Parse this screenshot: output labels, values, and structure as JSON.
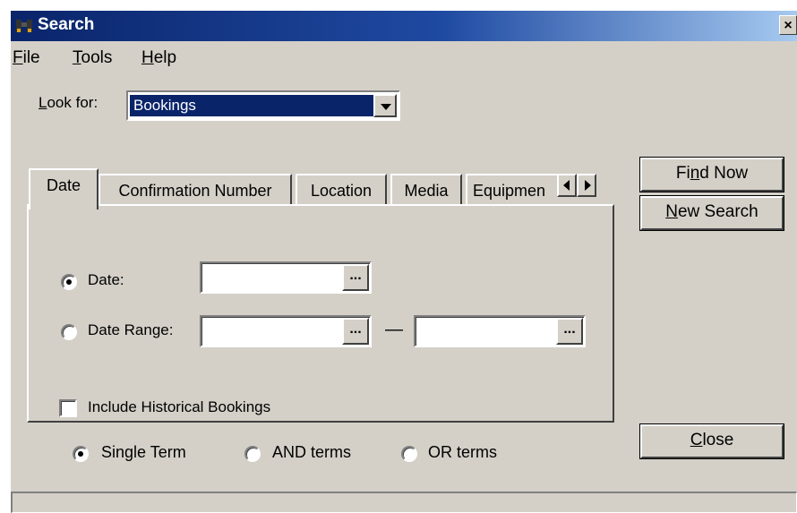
{
  "window": {
    "title": "Search",
    "close_glyph": "×"
  },
  "menu": [
    {
      "mnemonic": "F",
      "rest": "ile"
    },
    {
      "mnemonic": "T",
      "rest": "ools"
    },
    {
      "mnemonic": "H",
      "rest": "elp"
    }
  ],
  "look_for": {
    "mnemonic": "L",
    "rest": "ook for:",
    "selected": "Bookings"
  },
  "tabs": [
    "Date",
    "Confirmation Number",
    "Location",
    "Media",
    "Equipmen"
  ],
  "date_tab": {
    "date_label": "Date:",
    "date_selected": true,
    "date_range_label": "Date Range:",
    "date_range_selected": false,
    "date_value": "",
    "range_from": "",
    "range_to": "",
    "ellipsis": "...",
    "dash": "—",
    "historical_label": "Include Historical Bookings",
    "historical_checked": false
  },
  "buttons": {
    "find_now": {
      "pre": "Fi",
      "mnemonic": "n",
      "post": "d Now"
    },
    "new_search": {
      "mnemonic": "N",
      "rest": "ew Search"
    },
    "close": {
      "mnemonic": "C",
      "rest": "lose"
    }
  },
  "terms": {
    "single": "Single Term",
    "and": "AND terms",
    "or": "OR terms",
    "selected": "single"
  },
  "colors": {
    "title_start": "#0a246a",
    "title_end": "#a6caf0",
    "face": "#d4d0c8",
    "selection": "#0a246a"
  },
  "icons": {
    "title": "binoculars-icon"
  }
}
